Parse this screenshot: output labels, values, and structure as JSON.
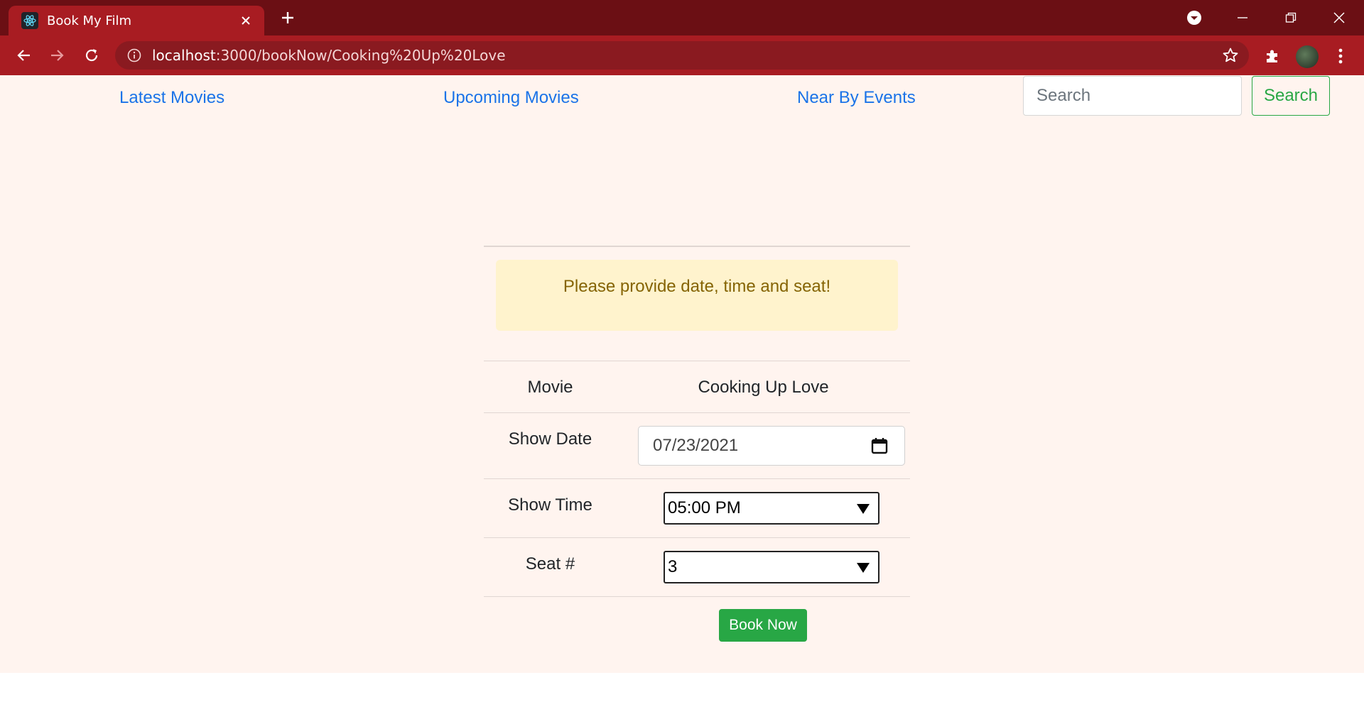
{
  "browser": {
    "tab_title": "Book My Film",
    "url_host": "localhost",
    "url_path": ":3000/bookNow/Cooking%20Up%20Love"
  },
  "navbar": {
    "links": [
      "Latest Movies",
      "Upcoming Movies",
      "Near By Events"
    ],
    "search_placeholder": "Search",
    "search_button": "Search"
  },
  "booking": {
    "alert": "Please provide date, time and seat!",
    "movie_label": "Movie",
    "movie_value": "Cooking Up Love",
    "date_label": "Show Date",
    "date_value": "07/23/2021",
    "time_label": "Show Time",
    "time_value": "05:00 PM",
    "seat_label": "Seat #",
    "seat_value": "3",
    "book_button": "Book Now"
  },
  "colors": {
    "browser_frame": "#6b0f14",
    "toolbar": "#a81c22",
    "page_bg": "#fff4ef",
    "link": "#1a73e8",
    "success": "#28a745",
    "alert_bg": "#fff3cd",
    "alert_text": "#856404"
  }
}
